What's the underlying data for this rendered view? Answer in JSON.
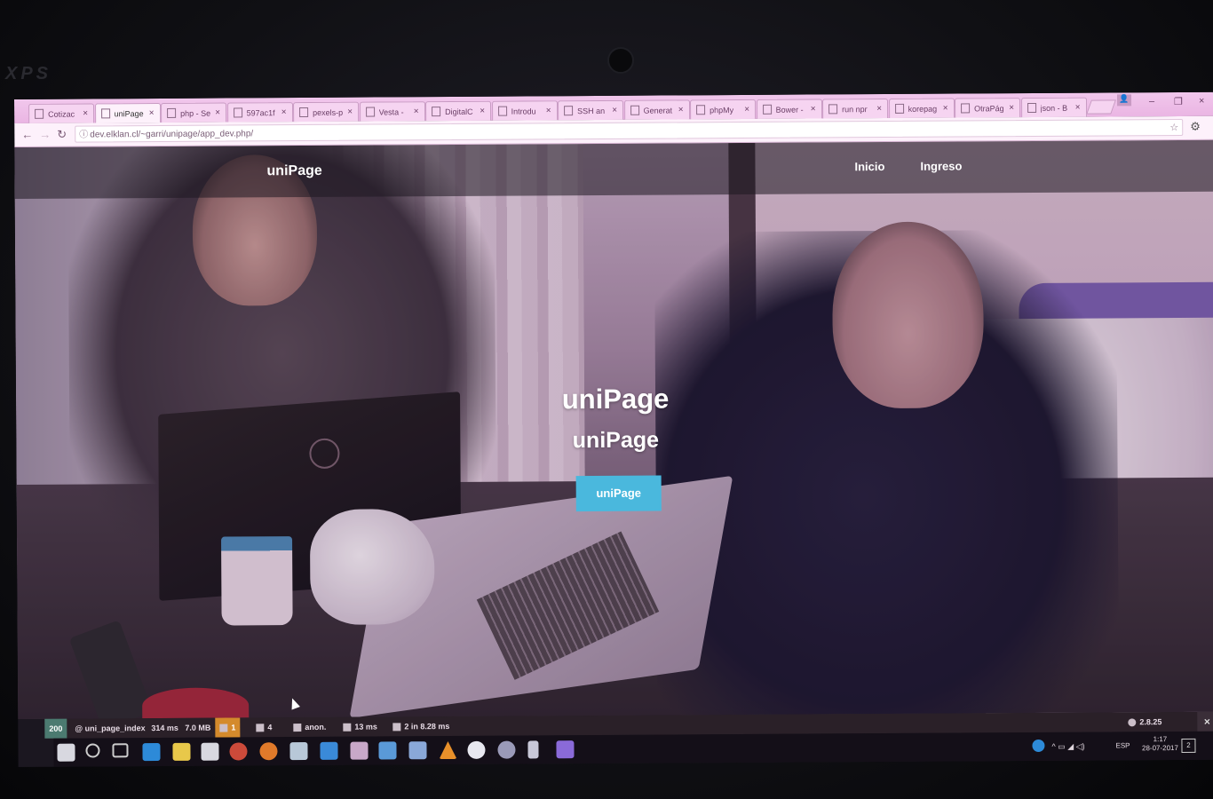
{
  "device": {
    "brand": "XPS"
  },
  "browser": {
    "tabs": [
      {
        "label": "Cotizac",
        "active": false
      },
      {
        "label": "uniPage",
        "active": true
      },
      {
        "label": "php - Se",
        "active": false
      },
      {
        "label": "597ac1f",
        "active": false
      },
      {
        "label": "pexels-p",
        "active": false
      },
      {
        "label": "Vesta -",
        "active": false
      },
      {
        "label": "DigitalC",
        "active": false
      },
      {
        "label": "Introdu",
        "active": false
      },
      {
        "label": "SSH an",
        "active": false
      },
      {
        "label": "Generat",
        "active": false
      },
      {
        "label": "phpMy",
        "active": false
      },
      {
        "label": "Bower -",
        "active": false
      },
      {
        "label": "run npr",
        "active": false
      },
      {
        "label": "korepag",
        "active": false
      },
      {
        "label": "OtraPág",
        "active": false
      },
      {
        "label": "json - B",
        "active": false
      }
    ],
    "url": "dev.elklan.cl/~garri/unipage/app_dev.php/",
    "icons": {
      "back": "←",
      "forward": "→",
      "reload": "↻",
      "info": "ⓘ",
      "bookmark": "☆",
      "menu": "⚙",
      "close": "×"
    },
    "window_controls": [
      "–",
      "❐",
      "×"
    ]
  },
  "site": {
    "brand": "uniPage",
    "nav": [
      "Inicio",
      "Ingreso"
    ],
    "hero": {
      "title": "uniPage",
      "subtitle": "uniPage",
      "button": "uniPage"
    },
    "accent": "#4ab8dd"
  },
  "debug_toolbar": {
    "status": "200",
    "route": "@ uni_page_index",
    "time": "314 ms",
    "memory": "7.0 MB",
    "warnings": "1",
    "translations": "4",
    "user": "anon.",
    "twig": "13 ms",
    "db": "2 in 8.28 ms",
    "version": "2.8.25",
    "close": "×"
  },
  "taskbar": {
    "language": "ESP",
    "time": "1:17",
    "date": "28-07-2017",
    "notification_count": "2"
  }
}
